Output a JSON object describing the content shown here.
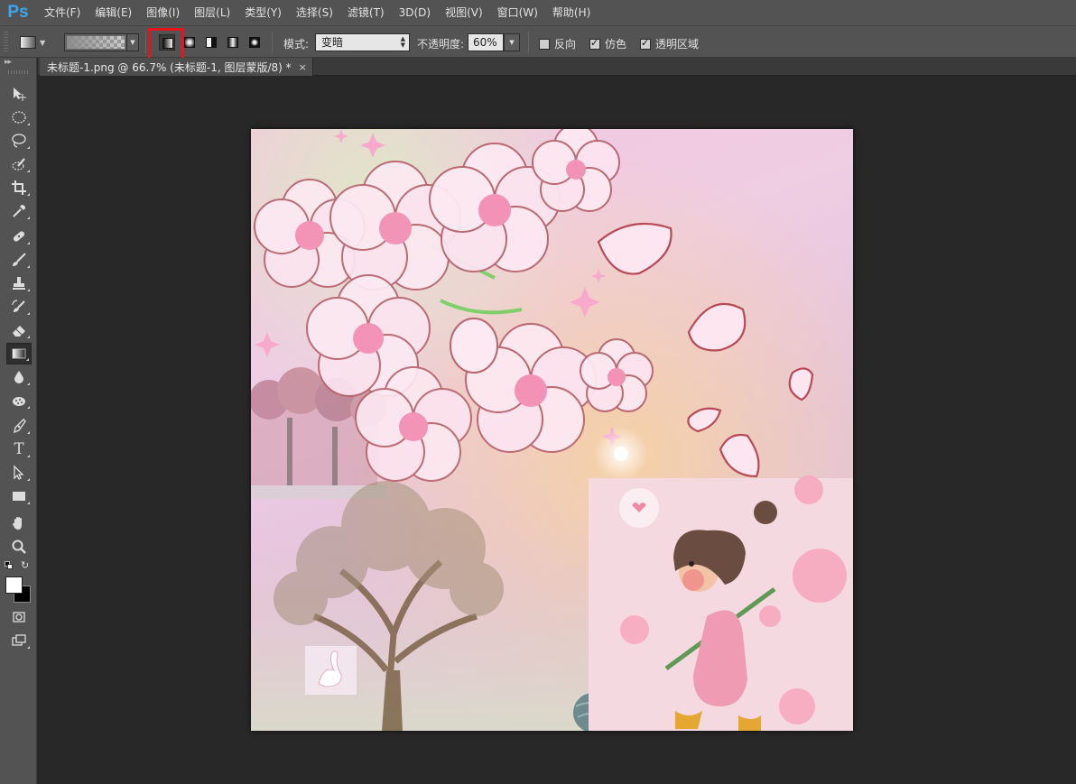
{
  "app": {
    "logo": "Ps"
  },
  "menu": [
    "文件(F)",
    "编辑(E)",
    "图像(I)",
    "图层(L)",
    "类型(Y)",
    "选择(S)",
    "滤镜(T)",
    "3D(D)",
    "视图(V)",
    "窗口(W)",
    "帮助(H)"
  ],
  "options": {
    "mode_label": "模式:",
    "mode_value": "变暗",
    "opacity_label": "不透明度:",
    "opacity_value": "60%",
    "reverse_label": "反向",
    "reverse_checked": false,
    "dither_label": "仿色",
    "dither_checked": true,
    "transparency_label": "透明区域",
    "transparency_checked": true,
    "gradient_types": [
      "linear-gradient",
      "radial-gradient",
      "angle-gradient",
      "reflected-gradient",
      "diamond-gradient"
    ],
    "selected_gradient_type": "linear-gradient",
    "highlight_color": "#e8131b"
  },
  "tools": [
    "move-tool",
    "elliptical-marquee-tool",
    "lasso-tool",
    "quick-selection-tool",
    "crop-tool",
    "eyedropper-tool",
    "spot-healing-brush-tool",
    "brush-tool",
    "clone-stamp-tool",
    "history-brush-tool",
    "eraser-tool",
    "gradient-tool",
    "blur-tool",
    "dodge-tool",
    "pen-tool",
    "type-tool",
    "path-selection-tool",
    "rectangle-tool",
    "hand-tool",
    "zoom-tool"
  ],
  "active_tool": "gradient-tool",
  "type_tool_glyph": "T",
  "colors": {
    "foreground": "#ffffff",
    "background": "#000000",
    "accent": "#3ea6f0"
  },
  "document": {
    "tab_title": "未标题-1.png @ 66.7% (未标题-1, 图层蒙版/8) *",
    "close_glyph": "×"
  }
}
